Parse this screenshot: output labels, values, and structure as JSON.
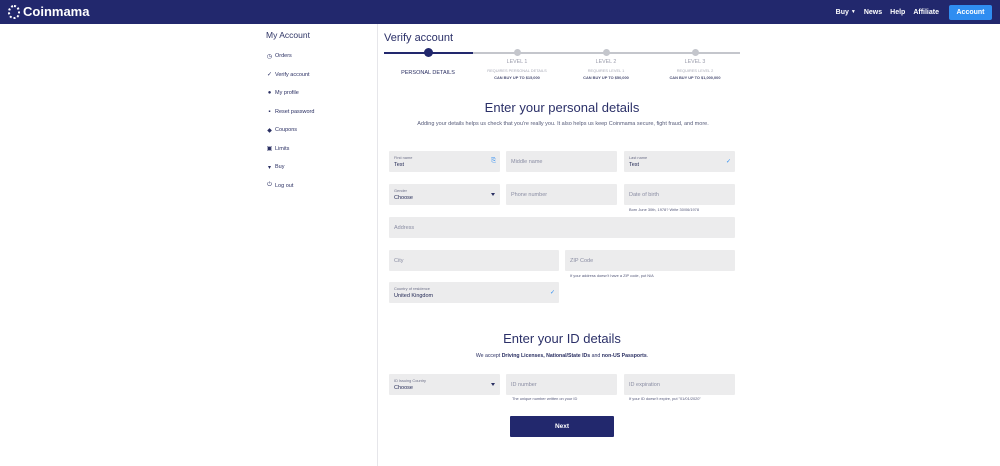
{
  "header": {
    "brand": "Coinmama",
    "nav": {
      "buy": "Buy",
      "news": "News",
      "help": "Help",
      "affiliate": "Affiliate"
    },
    "account_button": "Account"
  },
  "sidebar": {
    "title": "My Account",
    "items": [
      {
        "label": "Orders",
        "icon": "clock-icon"
      },
      {
        "label": "Verify account",
        "icon": "check-icon"
      },
      {
        "label": "My profile",
        "icon": "user-icon"
      },
      {
        "label": "Reset password",
        "icon": "lock-icon"
      },
      {
        "label": "Coupons",
        "icon": "tag-icon"
      },
      {
        "label": "Limits",
        "icon": "limits-icon"
      },
      {
        "label": "Buy",
        "icon": "cart-icon"
      },
      {
        "label": "Log out",
        "icon": "power-icon"
      }
    ]
  },
  "page": {
    "title": "Verify account"
  },
  "stepper": {
    "steps": [
      {
        "label": "PERSONAL DETAILS",
        "requires": "",
        "limit": ""
      },
      {
        "label": "LEVEL 1",
        "requires": "REQUIRES PERSONAL DETAILS",
        "limit": "CAN BUY UP TO $15,000"
      },
      {
        "label": "LEVEL 2",
        "requires": "REQUIRES LEVEL 1",
        "limit": "CAN BUY UP TO $50,000"
      },
      {
        "label": "LEVEL 3",
        "requires": "REQUIRES LEVEL 2",
        "limit": "CAN BUY UP TO $1,000,000"
      }
    ],
    "current_step": 0
  },
  "personal": {
    "heading": "Enter your personal details",
    "intro": "Adding your details helps us check that you're really you. It also helps us keep Coinmama secure, fight fraud, and more.",
    "first_name": {
      "label": "First name",
      "value": "Test"
    },
    "middle_name": {
      "placeholder": "Middle name"
    },
    "last_name": {
      "label": "Last name",
      "value": "Test"
    },
    "gender": {
      "label": "Gender",
      "value": "Choose"
    },
    "phone": {
      "placeholder": "Phone number"
    },
    "dob": {
      "placeholder": "Date of birth",
      "hint": "Born June 30th, 1978? Write 30/06/1978"
    },
    "address": {
      "placeholder": "Address"
    },
    "city": {
      "placeholder": "City"
    },
    "zip": {
      "placeholder": "ZIP Code",
      "hint": "If your address doesn't have a ZIP code, put N/A"
    },
    "country": {
      "label": "Country of residence",
      "value": "United Kingdom"
    }
  },
  "id_details": {
    "heading": "Enter your ID details",
    "accept_prefix": "We accept ",
    "accept_b1": "Driving Licenses, National/State IDs",
    "accept_mid": " and ",
    "accept_b2": "non-US Passports",
    "accept_suffix": ".",
    "id_country": {
      "label": "ID Issuing Country",
      "value": "Choose"
    },
    "id_number": {
      "placeholder": "ID number",
      "hint": "The unique number written on your ID"
    },
    "id_expiration": {
      "placeholder": "ID expiration",
      "hint": "If your ID doesn't expire, put \"01/01/2020\""
    }
  },
  "next_button": "Next",
  "colors": {
    "primary": "#22286d",
    "accent": "#2f8df1",
    "field": "#ececed"
  }
}
